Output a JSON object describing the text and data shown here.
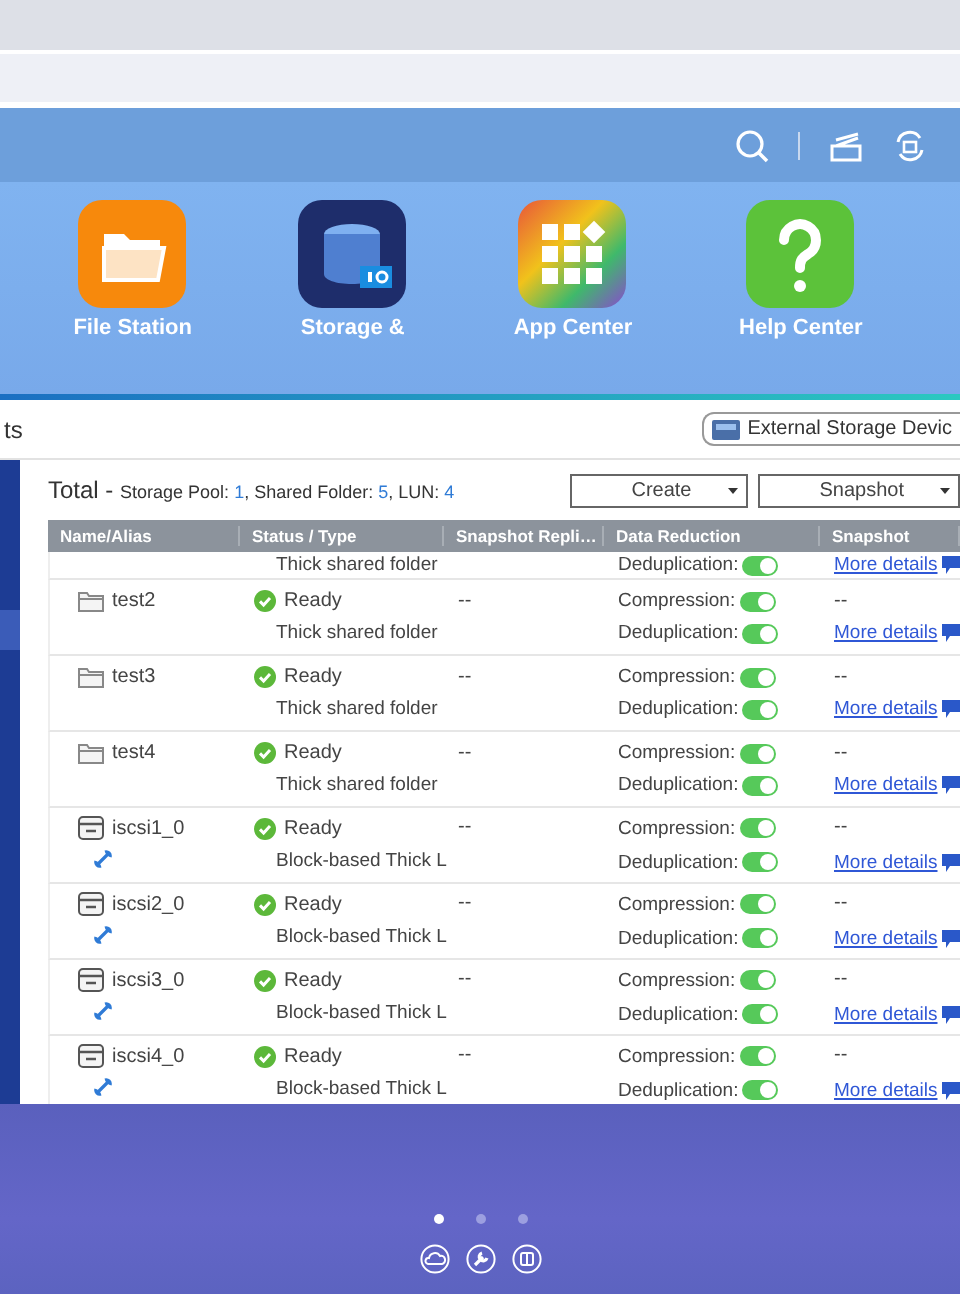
{
  "desktop": {
    "apps": [
      {
        "kind": "files",
        "label": "File Station"
      },
      {
        "kind": "storage",
        "label": "Storage &"
      },
      {
        "kind": "apps",
        "label": "App Center"
      },
      {
        "kind": "help",
        "label": "Help Center"
      }
    ],
    "pages": [
      {
        "selected": true
      },
      {
        "selected": false
      },
      {
        "selected": false
      }
    ]
  },
  "window": {
    "title": "ts",
    "external_button": "External Storage Devic",
    "summary": {
      "title": "Total",
      "dash": "-",
      "items": [
        {
          "label": "Storage Pool:",
          "value": "1"
        },
        {
          "label": ", Shared Folder:",
          "value": "5"
        },
        {
          "label": ", LUN:",
          "value": "4"
        }
      ]
    },
    "buttons": [
      "Create",
      "Snapshot"
    ],
    "table": {
      "columns": [
        "Name/Alias",
        "Status / Type",
        "Snapshot Repli…",
        "Data Reduction",
        "Snapshot"
      ],
      "rows": [
        {
          "kind": "partial",
          "type": "Thick shared folder",
          "dedup_label": "Deduplication:",
          "dedup": true,
          "details": "More details"
        },
        {
          "kind": "folder",
          "name": "test2",
          "status": "Ready",
          "type": "Thick shared folder",
          "replication": "--",
          "compression_label": "Compression:",
          "compression": true,
          "dedup_label": "Deduplication:",
          "dedup": true,
          "snapshot": "--",
          "details": "More details"
        },
        {
          "kind": "folder",
          "name": "test3",
          "status": "Ready",
          "type": "Thick shared folder",
          "replication": "--",
          "compression_label": "Compression:",
          "compression": true,
          "dedup_label": "Deduplication:",
          "dedup": true,
          "snapshot": "--",
          "details": "More details"
        },
        {
          "kind": "folder",
          "name": "test4",
          "status": "Ready",
          "type": "Thick shared folder",
          "replication": "--",
          "compression_label": "Compression:",
          "compression": true,
          "dedup_label": "Deduplication:",
          "dedup": true,
          "snapshot": "--",
          "details": "More details"
        },
        {
          "kind": "lun",
          "name": "iscsi1_0",
          "status": "Ready",
          "type": "Block-based Thick L",
          "replication": "--",
          "compression_label": "Compression:",
          "compression": true,
          "dedup_label": "Deduplication:",
          "dedup": true,
          "snapshot": "--",
          "details": "More details"
        },
        {
          "kind": "lun",
          "name": "iscsi2_0",
          "status": "Ready",
          "type": "Block-based Thick L",
          "replication": "--",
          "compression_label": "Compression:",
          "compression": true,
          "dedup_label": "Deduplication:",
          "dedup": true,
          "snapshot": "--",
          "details": "More details"
        },
        {
          "kind": "lun",
          "name": "iscsi3_0",
          "status": "Ready",
          "type": "Block-based Thick L",
          "replication": "--",
          "compression_label": "Compression:",
          "compression": true,
          "dedup_label": "Deduplication:",
          "dedup": true,
          "snapshot": "--",
          "details": "More details"
        },
        {
          "kind": "lun",
          "name": "iscsi4_0",
          "status": "Ready",
          "type": "Block-based Thick L",
          "replication": "--",
          "compression_label": "Compression:",
          "compression": true,
          "dedup_label": "Deduplication:",
          "dedup": true,
          "snapshot": "--",
          "details": "More details"
        }
      ]
    }
  }
}
